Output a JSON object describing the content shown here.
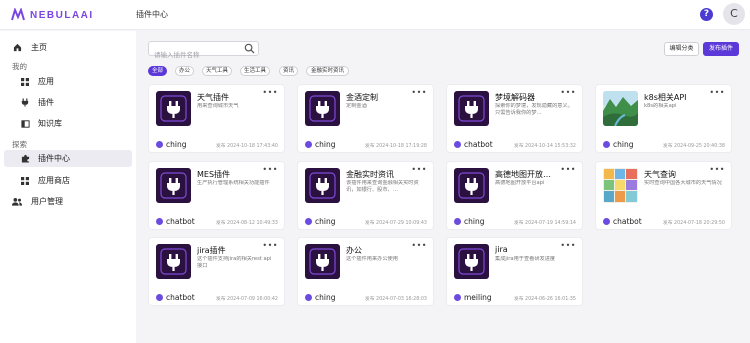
{
  "app": {
    "logo_text": "NEBULAAI",
    "page_title": "插件中心",
    "avatar_letter": "C",
    "help_label": "?"
  },
  "sidebar": {
    "home": "主页",
    "group_mine": "我的",
    "apps": "应用",
    "plugins": "插件",
    "knowledge": "知识库",
    "group_explore": "探索",
    "plugin_center": "插件中心",
    "app_store": "应用商店",
    "user_mgmt": "用户管理"
  },
  "toolbar": {
    "search_placeholder": "请输入插件名称",
    "edit_category": "编辑分类",
    "publish_plugin": "发布插件"
  },
  "filters": [
    "全部",
    "办公",
    "天气工具",
    "生活工具",
    "资讯",
    "金融实时资讯"
  ],
  "cards": [
    {
      "name": "天气插件",
      "desc": "用来查询城市天气",
      "author": "ching",
      "date": "发布 2024-10-18 17:43:40",
      "thumb": "plug"
    },
    {
      "name": "金酒定制",
      "desc": "定制金酒",
      "author": "ching",
      "date": "发布 2024-10-18 17:19:28",
      "thumb": "plug"
    },
    {
      "name": "梦境解码器",
      "desc": "探索你的梦境，发现隐藏的意义。只需告诉我你的梦…",
      "author": "chatbot",
      "date": "发布 2024-10-14 15:53:32",
      "thumb": "plug"
    },
    {
      "name": "k8s相关API",
      "desc": "k8s的相关api",
      "author": "ching",
      "date": "发布 2024-09-25 20:40:38",
      "thumb": "landscape"
    },
    {
      "name": "MES插件",
      "desc": "生产执行管理系统相关功能插件",
      "author": "chatbot",
      "date": "发布 2024-08-12 10:49:33",
      "thumb": "plug"
    },
    {
      "name": "金融实时资讯",
      "desc": "该插件用来查询金融相关实时资讯，如银行、股市、…",
      "author": "ching",
      "date": "发布 2024-07-29 10:09:43",
      "thumb": "plug"
    },
    {
      "name": "高德地图开放…",
      "desc": "高德地图开放平台api",
      "author": "ching",
      "date": "发布 2024-07-19 14:59:14",
      "thumb": "plug"
    },
    {
      "name": "天气查询",
      "desc": "实时查询中国各大城市的天气情况",
      "author": "chatbot",
      "date": "发布 2024-07-18 20:29:50",
      "thumb": "mosaic"
    },
    {
      "name": "jira插件",
      "desc": "这个插件支持jira的相关rest api接口",
      "author": "chatbot",
      "date": "发布 2024-07-09 16:00:42",
      "thumb": "plug"
    },
    {
      "name": "办公",
      "desc": "这个插件用来办公使用",
      "author": "ching",
      "date": "发布 2024-07-03 16:28:03",
      "thumb": "plug"
    },
    {
      "name": "jira",
      "desc": "集成jira用于查看研发进度",
      "author": "meiling",
      "date": "发布 2024-06-26 16:01:35",
      "thumb": "plug"
    }
  ],
  "colors": {
    "accent": "#5b39d8",
    "thumb_bg": "#2a1140"
  }
}
